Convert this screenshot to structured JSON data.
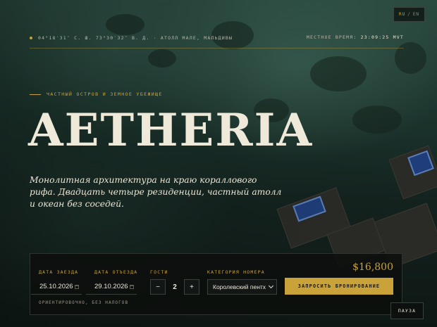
{
  "language": {
    "ru": "RU",
    "separator": "/",
    "en": "EN",
    "active": "RU"
  },
  "location": {
    "coordinates": "04°18′31″ С. Ш. 73°30′32″ В. Д. · АТОЛЛ МАЛЕ, МАЛЬДИВЫ",
    "local_time_label": "МЕСТНОЕ ВРЕМЯ:",
    "local_time_value": "23:09:25 MVT"
  },
  "hero": {
    "eyebrow": "ЧАСТНЫЙ ОСТРОВ И ЗЕМНОЕ УБЕЖИЩЕ",
    "title": "AETHERIA",
    "tagline": "Монолитная архитектура на краю кораллового рифа. Двадцать четыре резиденции, частный атолл и океан без соседей."
  },
  "booking": {
    "checkin_label": "ДАТА ЗАЕЗДА",
    "checkin_value": "25.10.2026",
    "checkout_label": "ДАТА ОТЪЕЗДА",
    "checkout_value": "29.10.2026",
    "guests_label": "ГОСТИ",
    "guests_minus": "−",
    "guests_value": "2",
    "guests_plus": "+",
    "category_label": "КАТЕГОРИЯ НОМЕРА",
    "category_value": "Королевский пентх",
    "price": "$16,800",
    "cta": "ЗАПРОСИТЬ БРОНИРОВАНИЕ",
    "note": "ОРИЕНТИРОВОЧНО, БЕЗ НАЛОГОВ"
  },
  "controls": {
    "pause": "ПАУЗА"
  },
  "colors": {
    "accent": "#c9a23a",
    "panel": "#0c0f0d",
    "text": "#e8e2d2"
  }
}
